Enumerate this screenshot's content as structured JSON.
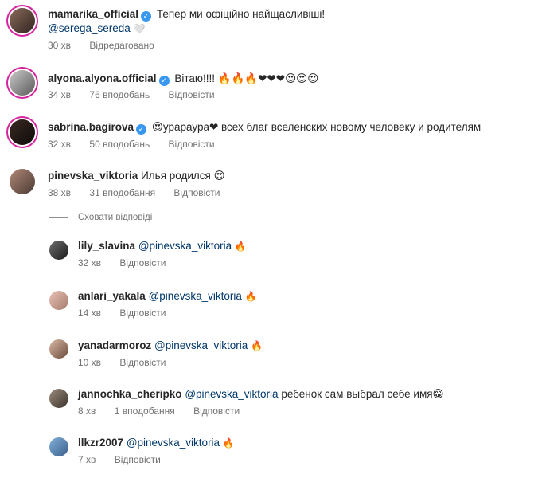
{
  "comments": [
    {
      "user": "mamarika_official",
      "verified": true,
      "mention": "",
      "text": "Тепер ми офіційно найщасливіші!",
      "line2_mention": "@serega_sereda",
      "line2_emoji": "🤍",
      "time": "30 хв",
      "likes": "",
      "reply": "Відредаговано"
    },
    {
      "user": "alyona.alyona.official",
      "verified": true,
      "mention": "",
      "text": "Вітаю!!!! 🔥🔥🔥❤❤❤😍😍😍",
      "time": "34 хв",
      "likes": "76 вподобань",
      "reply": "Відповісти"
    },
    {
      "user": "sabrina.bagirova",
      "verified": true,
      "mention": "",
      "text": "😍урараура❤ всех благ вселенских новому человеку и родителям",
      "time": "32 хв",
      "likes": "50 вподобань",
      "reply": "Відповісти"
    },
    {
      "user": "pinevska_viktoria",
      "verified": false,
      "mention": "",
      "text": "Илья родился 😍",
      "time": "38 хв",
      "likes": "31 вподобання",
      "reply": "Відповісти"
    }
  ],
  "hide_replies_label": "Сховати відповіді",
  "replies": [
    {
      "user": "lily_slavina",
      "mention": "@pinevska_viktoria",
      "text": "🔥",
      "time": "32 хв",
      "likes": "",
      "reply": "Відповісти"
    },
    {
      "user": "anlari_yakala",
      "mention": "@pinevska_viktoria",
      "text": "🔥",
      "time": "14 хв",
      "likes": "",
      "reply": "Відповісти"
    },
    {
      "user": "yanadarmoroz",
      "mention": "@pinevska_viktoria",
      "text": "🔥",
      "time": "10 хв",
      "likes": "",
      "reply": "Відповісти"
    },
    {
      "user": "jannochka_cheripko",
      "mention": "@pinevska_viktoria",
      "text": "ребенок сам выбрал себе имя😁",
      "time": "8 хв",
      "likes": "1 вподобання",
      "reply": "Відповісти"
    },
    {
      "user": "llkzr2007",
      "mention": "@pinevska_viktoria",
      "text": "🔥",
      "time": "7 хв",
      "likes": "",
      "reply": "Відповісти"
    }
  ],
  "colors": {
    "mention": "#00376b",
    "verified": "#3897f0",
    "meta": "#737373"
  }
}
